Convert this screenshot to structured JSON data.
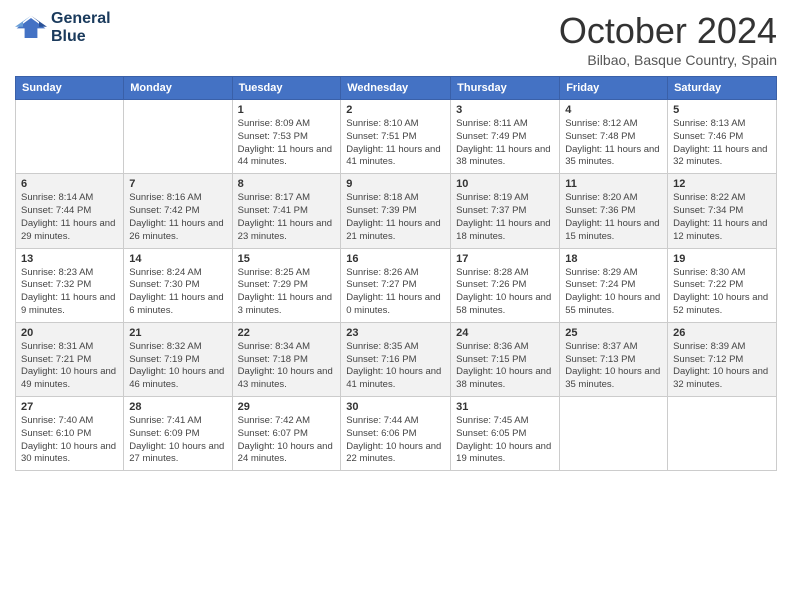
{
  "header": {
    "logo_line1": "General",
    "logo_line2": "Blue",
    "month": "October 2024",
    "location": "Bilbao, Basque Country, Spain"
  },
  "weekdays": [
    "Sunday",
    "Monday",
    "Tuesday",
    "Wednesday",
    "Thursday",
    "Friday",
    "Saturday"
  ],
  "weeks": [
    [
      {
        "day": "",
        "sunrise": "",
        "sunset": "",
        "daylight": ""
      },
      {
        "day": "",
        "sunrise": "",
        "sunset": "",
        "daylight": ""
      },
      {
        "day": "1",
        "sunrise": "Sunrise: 8:09 AM",
        "sunset": "Sunset: 7:53 PM",
        "daylight": "Daylight: 11 hours and 44 minutes."
      },
      {
        "day": "2",
        "sunrise": "Sunrise: 8:10 AM",
        "sunset": "Sunset: 7:51 PM",
        "daylight": "Daylight: 11 hours and 41 minutes."
      },
      {
        "day": "3",
        "sunrise": "Sunrise: 8:11 AM",
        "sunset": "Sunset: 7:49 PM",
        "daylight": "Daylight: 11 hours and 38 minutes."
      },
      {
        "day": "4",
        "sunrise": "Sunrise: 8:12 AM",
        "sunset": "Sunset: 7:48 PM",
        "daylight": "Daylight: 11 hours and 35 minutes."
      },
      {
        "day": "5",
        "sunrise": "Sunrise: 8:13 AM",
        "sunset": "Sunset: 7:46 PM",
        "daylight": "Daylight: 11 hours and 32 minutes."
      }
    ],
    [
      {
        "day": "6",
        "sunrise": "Sunrise: 8:14 AM",
        "sunset": "Sunset: 7:44 PM",
        "daylight": "Daylight: 11 hours and 29 minutes."
      },
      {
        "day": "7",
        "sunrise": "Sunrise: 8:16 AM",
        "sunset": "Sunset: 7:42 PM",
        "daylight": "Daylight: 11 hours and 26 minutes."
      },
      {
        "day": "8",
        "sunrise": "Sunrise: 8:17 AM",
        "sunset": "Sunset: 7:41 PM",
        "daylight": "Daylight: 11 hours and 23 minutes."
      },
      {
        "day": "9",
        "sunrise": "Sunrise: 8:18 AM",
        "sunset": "Sunset: 7:39 PM",
        "daylight": "Daylight: 11 hours and 21 minutes."
      },
      {
        "day": "10",
        "sunrise": "Sunrise: 8:19 AM",
        "sunset": "Sunset: 7:37 PM",
        "daylight": "Daylight: 11 hours and 18 minutes."
      },
      {
        "day": "11",
        "sunrise": "Sunrise: 8:20 AM",
        "sunset": "Sunset: 7:36 PM",
        "daylight": "Daylight: 11 hours and 15 minutes."
      },
      {
        "day": "12",
        "sunrise": "Sunrise: 8:22 AM",
        "sunset": "Sunset: 7:34 PM",
        "daylight": "Daylight: 11 hours and 12 minutes."
      }
    ],
    [
      {
        "day": "13",
        "sunrise": "Sunrise: 8:23 AM",
        "sunset": "Sunset: 7:32 PM",
        "daylight": "Daylight: 11 hours and 9 minutes."
      },
      {
        "day": "14",
        "sunrise": "Sunrise: 8:24 AM",
        "sunset": "Sunset: 7:30 PM",
        "daylight": "Daylight: 11 hours and 6 minutes."
      },
      {
        "day": "15",
        "sunrise": "Sunrise: 8:25 AM",
        "sunset": "Sunset: 7:29 PM",
        "daylight": "Daylight: 11 hours and 3 minutes."
      },
      {
        "day": "16",
        "sunrise": "Sunrise: 8:26 AM",
        "sunset": "Sunset: 7:27 PM",
        "daylight": "Daylight: 11 hours and 0 minutes."
      },
      {
        "day": "17",
        "sunrise": "Sunrise: 8:28 AM",
        "sunset": "Sunset: 7:26 PM",
        "daylight": "Daylight: 10 hours and 58 minutes."
      },
      {
        "day": "18",
        "sunrise": "Sunrise: 8:29 AM",
        "sunset": "Sunset: 7:24 PM",
        "daylight": "Daylight: 10 hours and 55 minutes."
      },
      {
        "day": "19",
        "sunrise": "Sunrise: 8:30 AM",
        "sunset": "Sunset: 7:22 PM",
        "daylight": "Daylight: 10 hours and 52 minutes."
      }
    ],
    [
      {
        "day": "20",
        "sunrise": "Sunrise: 8:31 AM",
        "sunset": "Sunset: 7:21 PM",
        "daylight": "Daylight: 10 hours and 49 minutes."
      },
      {
        "day": "21",
        "sunrise": "Sunrise: 8:32 AM",
        "sunset": "Sunset: 7:19 PM",
        "daylight": "Daylight: 10 hours and 46 minutes."
      },
      {
        "day": "22",
        "sunrise": "Sunrise: 8:34 AM",
        "sunset": "Sunset: 7:18 PM",
        "daylight": "Daylight: 10 hours and 43 minutes."
      },
      {
        "day": "23",
        "sunrise": "Sunrise: 8:35 AM",
        "sunset": "Sunset: 7:16 PM",
        "daylight": "Daylight: 10 hours and 41 minutes."
      },
      {
        "day": "24",
        "sunrise": "Sunrise: 8:36 AM",
        "sunset": "Sunset: 7:15 PM",
        "daylight": "Daylight: 10 hours and 38 minutes."
      },
      {
        "day": "25",
        "sunrise": "Sunrise: 8:37 AM",
        "sunset": "Sunset: 7:13 PM",
        "daylight": "Daylight: 10 hours and 35 minutes."
      },
      {
        "day": "26",
        "sunrise": "Sunrise: 8:39 AM",
        "sunset": "Sunset: 7:12 PM",
        "daylight": "Daylight: 10 hours and 32 minutes."
      }
    ],
    [
      {
        "day": "27",
        "sunrise": "Sunrise: 7:40 AM",
        "sunset": "Sunset: 6:10 PM",
        "daylight": "Daylight: 10 hours and 30 minutes."
      },
      {
        "day": "28",
        "sunrise": "Sunrise: 7:41 AM",
        "sunset": "Sunset: 6:09 PM",
        "daylight": "Daylight: 10 hours and 27 minutes."
      },
      {
        "day": "29",
        "sunrise": "Sunrise: 7:42 AM",
        "sunset": "Sunset: 6:07 PM",
        "daylight": "Daylight: 10 hours and 24 minutes."
      },
      {
        "day": "30",
        "sunrise": "Sunrise: 7:44 AM",
        "sunset": "Sunset: 6:06 PM",
        "daylight": "Daylight: 10 hours and 22 minutes."
      },
      {
        "day": "31",
        "sunrise": "Sunrise: 7:45 AM",
        "sunset": "Sunset: 6:05 PM",
        "daylight": "Daylight: 10 hours and 19 minutes."
      },
      {
        "day": "",
        "sunrise": "",
        "sunset": "",
        "daylight": ""
      },
      {
        "day": "",
        "sunrise": "",
        "sunset": "",
        "daylight": ""
      }
    ]
  ]
}
